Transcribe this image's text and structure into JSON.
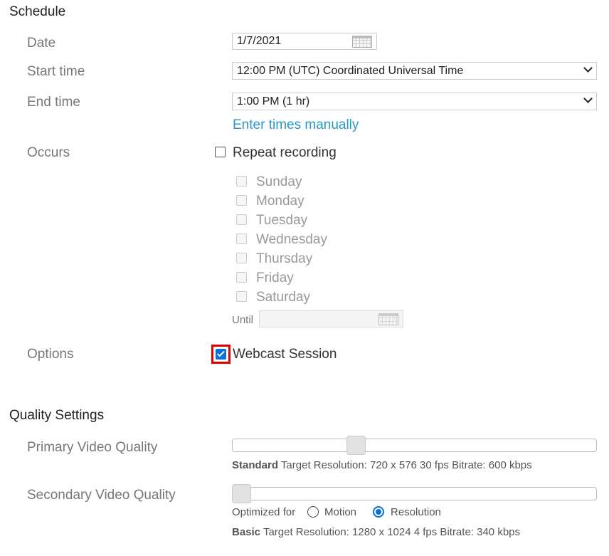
{
  "schedule": {
    "title": "Schedule",
    "date_label": "Date",
    "date_value": "1/7/2021",
    "start_label": "Start time",
    "start_value": "12:00 PM (UTC) Coordinated Universal Time",
    "end_label": "End time",
    "end_value": "1:00 PM (1 hr)",
    "manual_link": "Enter times manually",
    "occurs_label": "Occurs",
    "repeat_label": "Repeat recording",
    "repeat_checked": false,
    "days": [
      "Sunday",
      "Monday",
      "Tuesday",
      "Wednesday",
      "Thursday",
      "Friday",
      "Saturday"
    ],
    "until_label": "Until",
    "until_value": "",
    "options_label": "Options",
    "webcast_label": "Webcast Session",
    "webcast_checked": true
  },
  "quality": {
    "title": "Quality Settings",
    "primary_label": "Primary Video Quality",
    "primary_level": 0.33,
    "primary_level_name": "Standard",
    "primary_info": "Target Resolution: 720 x 576 30 fps Bitrate: 600 kbps",
    "secondary_label": "Secondary Video Quality",
    "secondary_level": 0.0,
    "optimized_label": "Optimized for",
    "motion_label": "Motion",
    "resolution_label": "Resolution",
    "selected_optimization": "Resolution",
    "secondary_level_name": "Basic",
    "secondary_info": "Target Resolution: 1280 x 1024 4 fps Bitrate: 340 kbps"
  },
  "colors": {
    "accent": "#0a70de",
    "link": "#2a98c8",
    "highlight_border": "#e00000"
  }
}
